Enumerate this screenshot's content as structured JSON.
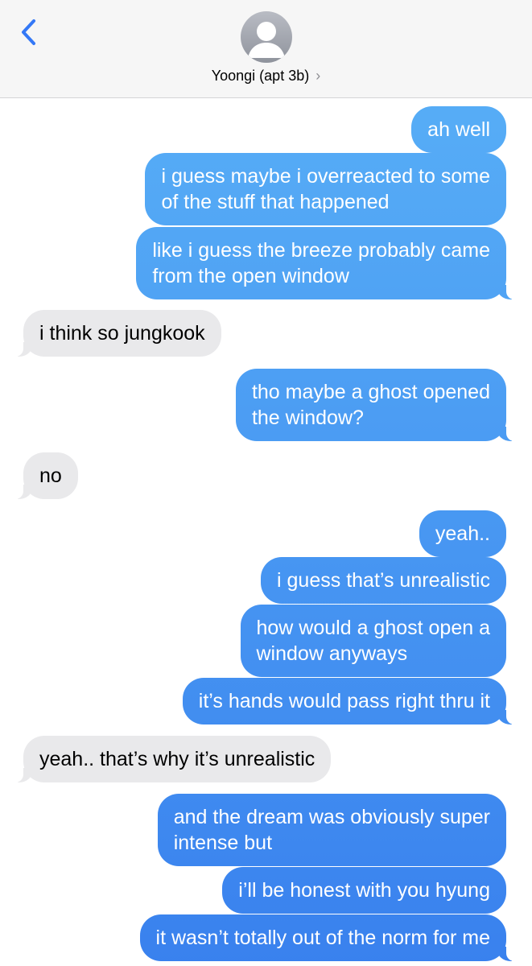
{
  "header": {
    "contact_name": "Yoongi (apt 3b)",
    "chevron": "›",
    "back_icon": "chevron-left-icon",
    "avatar_icon": "person-silhouette-icon",
    "accent_color": "#3478f6"
  },
  "messages": [
    {
      "from": "me",
      "text": "ah well"
    },
    {
      "from": "me",
      "lines": [
        "i guess maybe i overreacted to some",
        "of the stuff that happened"
      ]
    },
    {
      "from": "me",
      "lines": [
        "like i guess the breeze probably came",
        "from the open window"
      ]
    },
    {
      "from": "them",
      "text": "i think so jungkook"
    },
    {
      "from": "me",
      "lines": [
        "tho maybe a ghost opened",
        "the window?"
      ]
    },
    {
      "from": "them",
      "text": "no"
    },
    {
      "from": "me",
      "text": "yeah.."
    },
    {
      "from": "me",
      "text": "i guess that’s unrealistic"
    },
    {
      "from": "me",
      "lines": [
        "how would a ghost open a",
        "window anyways"
      ]
    },
    {
      "from": "me",
      "text": "it’s hands would pass right thru it"
    },
    {
      "from": "them",
      "text": "yeah.. that’s why it’s unrealistic"
    },
    {
      "from": "me",
      "lines": [
        "and the dream was obviously super",
        "intense but"
      ]
    },
    {
      "from": "me",
      "text": "i’ll be honest with you hyung"
    },
    {
      "from": "me",
      "text": "it wasn’t totally out of the norm for me"
    }
  ]
}
